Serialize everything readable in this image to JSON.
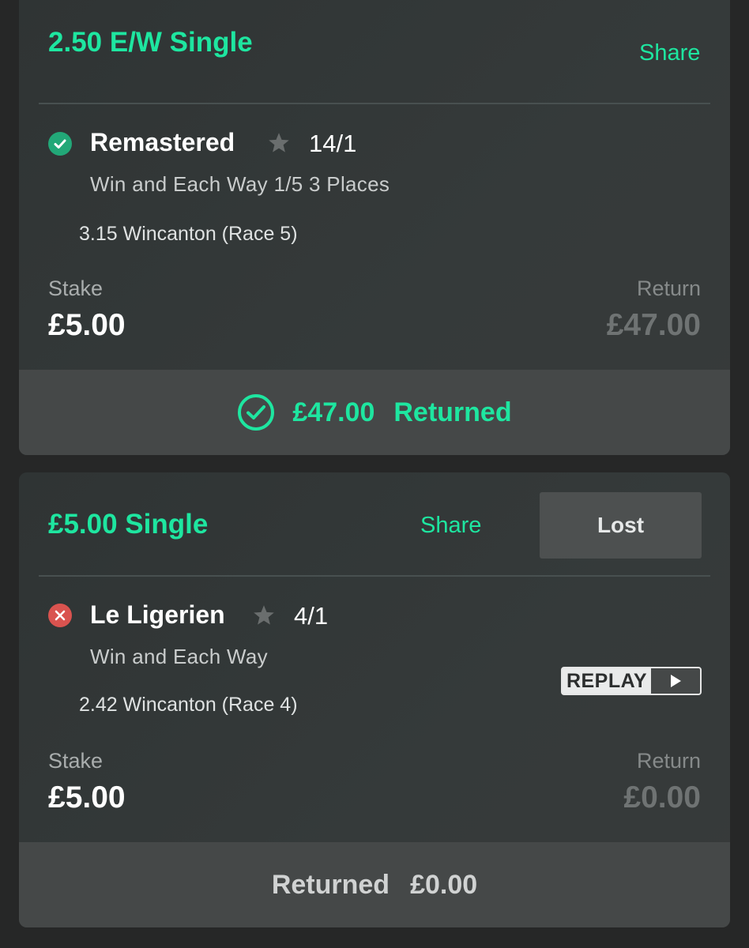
{
  "bets": [
    {
      "title": "2.50 E/W Single",
      "share_label": "Share",
      "status_icon": "check-circle-icon",
      "runner": "Remastered",
      "odds": "14/1",
      "market": "Win and Each Way 1/5 3 Places",
      "event": "3.15 Wincanton (Race 5)",
      "stake_label": "Stake",
      "stake": "£5.00",
      "return_label": "Return",
      "return": "£47.00",
      "footer_amount": "£47.00",
      "footer_label": "Returned"
    },
    {
      "title": "£5.00 Single",
      "share_label": "Share",
      "result_badge": "Lost",
      "status_icon": "cross-circle-icon",
      "runner": "Le Ligerien",
      "odds": "4/1",
      "market": "Win and Each Way",
      "event": "2.42 Wincanton (Race 4)",
      "replay_label": "REPLAY",
      "stake_label": "Stake",
      "stake": "£5.00",
      "return_label": "Return",
      "return": "£0.00",
      "footer_label": "Returned",
      "footer_amount": "£0.00"
    }
  ],
  "colors": {
    "accent": "#1ee6a0",
    "win_icon": "#22a878",
    "loss_icon": "#d9534f",
    "background": "#262727"
  }
}
